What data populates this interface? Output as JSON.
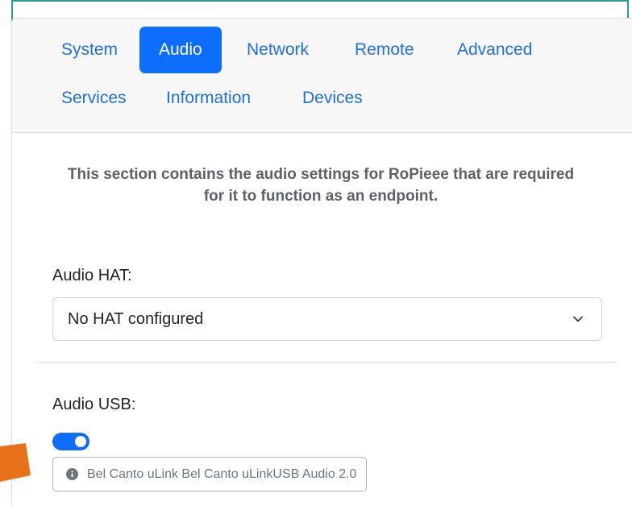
{
  "tabs": [
    {
      "label": "System",
      "active": false
    },
    {
      "label": "Audio",
      "active": true
    },
    {
      "label": "Network",
      "active": false
    },
    {
      "label": "Remote",
      "active": false
    },
    {
      "label": "Advanced",
      "active": false
    },
    {
      "label": "Services",
      "active": false
    },
    {
      "label": "Information",
      "active": false
    },
    {
      "label": "Devices",
      "active": false
    }
  ],
  "intro": {
    "line1": "This section contains the audio settings for RoPieee that are required",
    "line2": "for it to function as an endpoint."
  },
  "audio_hat": {
    "label": "Audio HAT:",
    "selected": "No HAT configured"
  },
  "audio_usb": {
    "label": "Audio USB:",
    "enabled": true,
    "device": "Bel Canto uLink Bel Canto uLinkUSB Audio 2.0"
  },
  "colors": {
    "accent": "#0d6efd",
    "link": "#1f6fe0",
    "frame_border": "#2a9d8f",
    "annotation_arrow": "#e8711c"
  },
  "icons": {
    "select_caret": "chevron-down-icon",
    "device_info": "info-circle-icon",
    "annotation": "arrow-icon"
  }
}
